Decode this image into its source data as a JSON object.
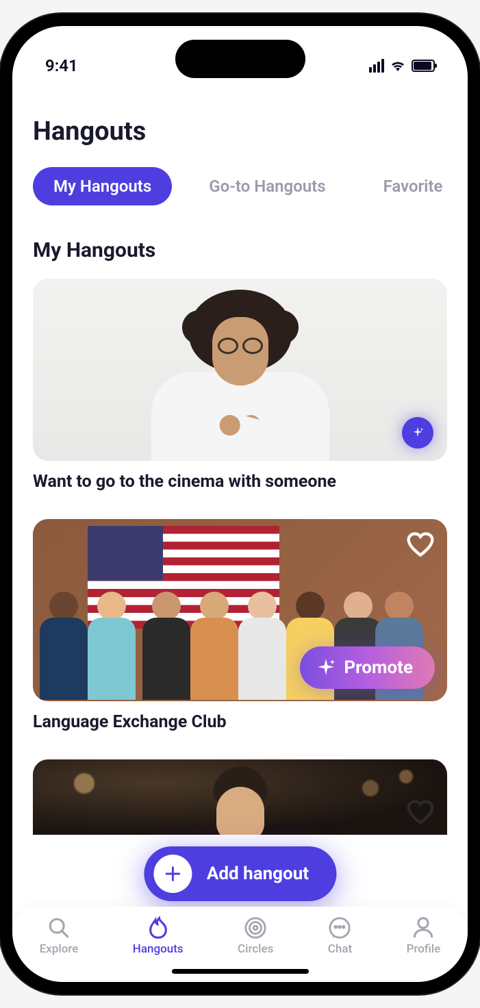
{
  "status": {
    "time": "9:41"
  },
  "page": {
    "title": "Hangouts"
  },
  "tabs": [
    {
      "label": "My Hangouts",
      "active": true
    },
    {
      "label": "Go-to Hangouts",
      "active": false
    },
    {
      "label": "Favorite Hangouts",
      "active": false
    }
  ],
  "section": {
    "title": "My Hangouts"
  },
  "cards": [
    {
      "title": "Want to go to the cinema with someone",
      "has_sparkle": true
    },
    {
      "title": "Language Exchange Club",
      "has_heart": true,
      "promote_label": "Promote"
    }
  ],
  "fab": {
    "label": "Add hangout"
  },
  "nav": [
    {
      "label": "Explore",
      "icon": "search-icon",
      "active": false
    },
    {
      "label": "Hangouts",
      "icon": "flame-icon",
      "active": true
    },
    {
      "label": "Circles",
      "icon": "target-icon",
      "active": false
    },
    {
      "label": "Chat",
      "icon": "chat-icon",
      "active": false
    },
    {
      "label": "Profile",
      "icon": "person-icon",
      "active": false
    }
  ],
  "colors": {
    "primary": "#4e3ee0"
  }
}
